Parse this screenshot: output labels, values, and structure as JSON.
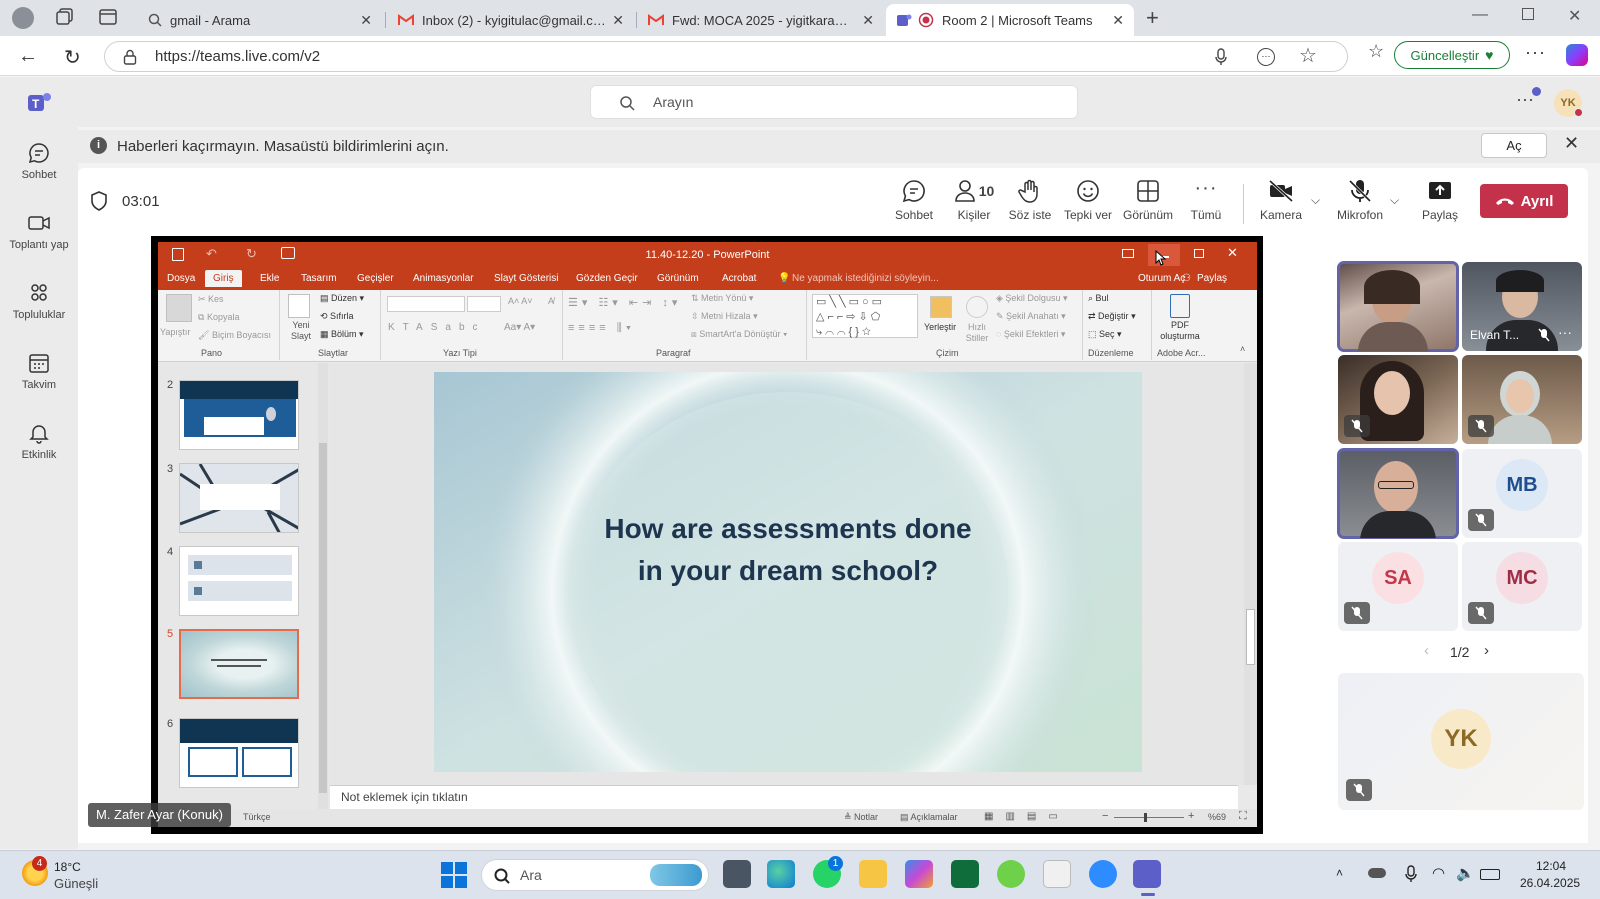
{
  "browser": {
    "tabs": [
      {
        "title": "gmail - Arama"
      },
      {
        "title": "Inbox (2) - kyigitulac@gmail.com"
      },
      {
        "title": "Fwd: MOCA 2025 - yigitkara@og"
      },
      {
        "title": "Room 2 | Microsoft Teams"
      }
    ],
    "url": "https://teams.live.com/v2",
    "update_button": "Güncelleştir"
  },
  "teams": {
    "search_placeholder": "Arayın",
    "user_initials": "YK",
    "rail": [
      "Sohbet",
      "Toplantı yap",
      "Topluluklar",
      "Takvim",
      "Etkinlik"
    ],
    "banner_text": "Haberleri kaçırmayın. Masaüstü bildirimlerini açın.",
    "banner_button": "Aç",
    "meeting": {
      "timer": "03:01",
      "people_count": "10",
      "toolbar": [
        "Sohbet",
        "Kişiler",
        "Söz iste",
        "Tepki ver",
        "Görünüm",
        "Tümü",
        "Kamera",
        "Mikrofon",
        "Paylaş"
      ],
      "leave_label": "Ayrıl",
      "presenter_label": "M. Zafer Ayar (Konuk)",
      "participants": [
        {
          "initials": "MB",
          "color": "#1f4e8c"
        },
        {
          "initials": "SA",
          "color": "#c2374a"
        },
        {
          "initials": "MC",
          "color": "#9c2f45"
        },
        {
          "initials": "YK",
          "color": "#8a6a26"
        }
      ],
      "named_participant": "Elvan T...",
      "pagination": "1/2"
    }
  },
  "powerpoint": {
    "title": "11.40-12.20 - PowerPoint",
    "menu": [
      "Dosya",
      "Giriş",
      "Ekle",
      "Tasarım",
      "Geçişler",
      "Animasyonlar",
      "Slayt Gösterisi",
      "Gözden Geçir",
      "Görünüm",
      "Acrobat"
    ],
    "tell_me": "Ne yapmak istediğinizi söyleyin...",
    "sign_in": "Oturum Aç",
    "share": "Paylaş",
    "ribbon_groups": [
      "Pano",
      "Slaytlar",
      "Yazı Tipi",
      "Paragraf",
      "Çizim",
      "Düzenleme",
      "Adobe Acr..."
    ],
    "ribbon_items": {
      "paste": "Yapıştır",
      "cut": "Kes",
      "copy": "Kopyala",
      "format_painter": "Biçim Boyacısı",
      "new_slide": "Yeni Slayt",
      "layout": "Düzen",
      "reset": "Sıfırla",
      "section": "Bölüm",
      "text_direction": "Metin Yönü",
      "align_text": "Metni Hizala",
      "smartart": "SmartArt'a Dönüştür",
      "arrange": "Yerleştir",
      "quick_styles": "Hızlı Stiller",
      "shape_fill": "Şekil Dolgusu",
      "shape_outline": "Şekil Anahatı",
      "shape_effects": "Şekil Efektleri",
      "find": "Bul",
      "replace": "Değiştir",
      "select": "Seç",
      "pdf": "PDF oluşturma"
    },
    "slide_numbers": [
      "2",
      "3",
      "4",
      "5",
      "6"
    ],
    "slide_text_line1": "How are assessments done",
    "slide_text_line2": "in your dream school?",
    "notes_placeholder": "Not eklemek için tıklatın",
    "status": {
      "language": "Türkçe",
      "notes": "Notlar",
      "comments": "Açıklamalar",
      "zoom": "%69"
    }
  },
  "taskbar": {
    "weather_temp": "18°C",
    "weather_desc": "Güneşli",
    "weather_badge": "4",
    "search": "Ara",
    "whatsapp_badge": "1",
    "time": "12:04",
    "date": "26.04.2025"
  }
}
